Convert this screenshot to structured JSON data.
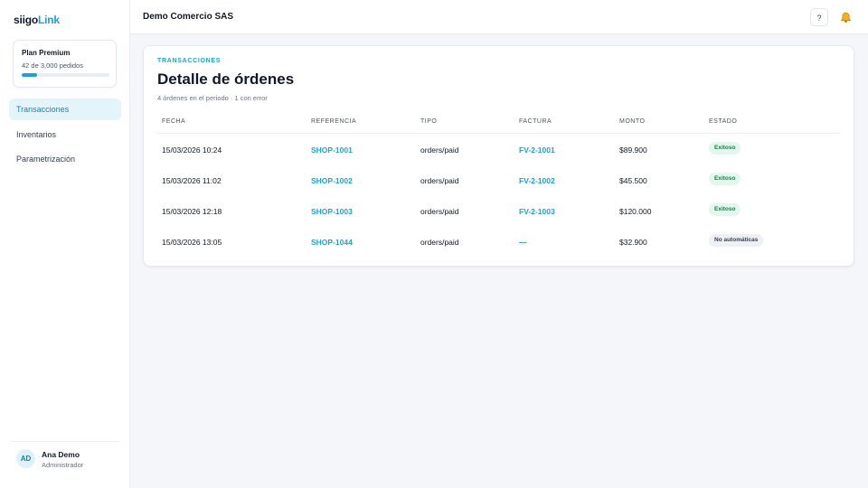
{
  "brand": {
    "prefix": "siigo",
    "suffix": "Link"
  },
  "plan": {
    "name": "Plan Premium",
    "usage": "42 de 3,000 pedidos",
    "progress_fraction": 0.18
  },
  "nav": {
    "items": [
      {
        "label": "Transacciones",
        "active": true
      },
      {
        "label": "Inventarios",
        "active": false
      },
      {
        "label": "Parametrización",
        "active": false
      }
    ]
  },
  "user": {
    "initials": "AD",
    "name": "Ana Demo",
    "role": "Administrador"
  },
  "header": {
    "company": "Demo Comercio SAS",
    "help_label": "?",
    "icons": [
      "help-icon",
      "bell-icon"
    ]
  },
  "main": {
    "eyebrow": "TRANSACCIONES",
    "title": "Detalle de órdenes",
    "subtitle": "4 órdenes en el periodo · 1 con error",
    "columns": [
      "FECHA",
      "REFERENCIA",
      "TIPO",
      "FACTURA",
      "MONTO",
      "ESTADO"
    ],
    "rows": [
      {
        "fecha": "15/03/2026 10:24",
        "referencia": "SHOP-1001",
        "tipo": "orders/paid",
        "factura": "FV-2-1001",
        "monto": "$89.900",
        "estado": "Exitoso"
      },
      {
        "fecha": "15/03/2026 11:02",
        "referencia": "SHOP-1002",
        "tipo": "orders/paid",
        "factura": "FV-2-1002",
        "monto": "$45.500",
        "estado": "Exitoso"
      },
      {
        "fecha": "15/03/2026 12:18",
        "referencia": "SHOP-1003",
        "tipo": "orders/paid",
        "factura": "FV-2-1003",
        "monto": "$120.000",
        "estado": "Exitoso"
      },
      {
        "fecha": "15/03/2026 13:05",
        "referencia": "SHOP-1044",
        "tipo": "orders/paid",
        "factura": "—",
        "monto": "$32.900",
        "estado": "No automáticas"
      }
    ]
  },
  "colors": {
    "accent": "#1aa3d9",
    "success_bg": "#e3f7ec",
    "success_text": "#1f7a4a",
    "neutral_bg": "#eef0f3",
    "bell": "#f2b01e"
  }
}
